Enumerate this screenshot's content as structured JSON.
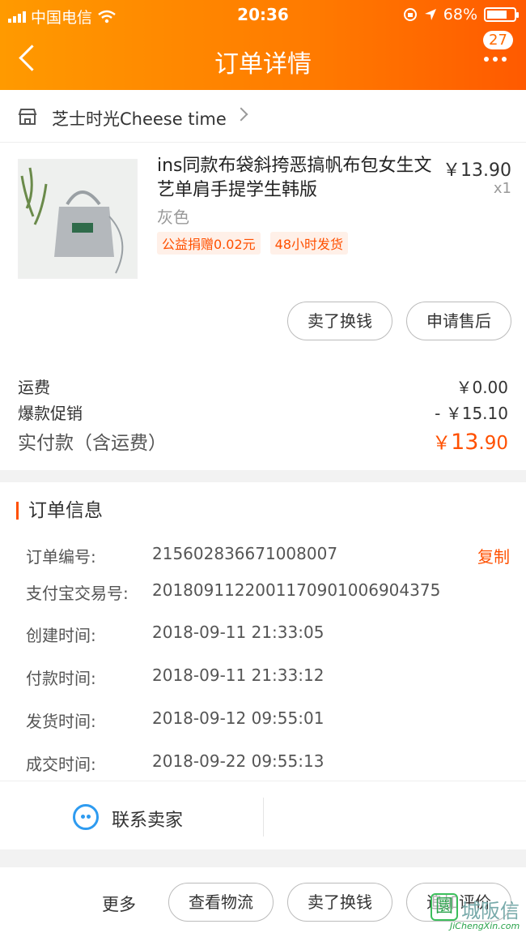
{
  "status_bar": {
    "carrier": "中国电信",
    "time": "20:36",
    "battery": "68%"
  },
  "header": {
    "title": "订单详情",
    "badge_count": "27"
  },
  "shop": {
    "name": "芝士时光Cheese time"
  },
  "product": {
    "title": "ins同款布袋斜挎恶搞帆布包女生文艺单肩手提学生韩版",
    "price": "￥13.90",
    "quantity": "x1",
    "sku": "灰色",
    "tags": [
      "公益捐赠0.02元",
      "48小时发货"
    ],
    "actions": {
      "sell": "卖了换钱",
      "after_sale": "申请售后"
    }
  },
  "fees": {
    "shipping_label": "运费",
    "shipping_value": "￥0.00",
    "promo_label": "爆款促销",
    "promo_value": "- ￥15.10",
    "total_label": "实付款（含运费）",
    "total_currency": "￥",
    "total_int": "13",
    "total_dec": ".90"
  },
  "order_info": {
    "title": "订单信息",
    "copy_label": "复制",
    "rows": [
      {
        "key": "订单编号:",
        "value": "215602836671008007"
      },
      {
        "key": "支付宝交易号:",
        "value": "2018091122001170901006904375"
      },
      {
        "key": "创建时间:",
        "value": "2018-09-11 21:33:05"
      },
      {
        "key": "付款时间:",
        "value": "2018-09-11 21:33:12"
      },
      {
        "key": "发货时间:",
        "value": "2018-09-12 09:55:01"
      },
      {
        "key": "成交时间:",
        "value": "2018-09-22 09:55:13"
      }
    ]
  },
  "contact": {
    "label": "联系卖家"
  },
  "bottom_bar": {
    "more": "更多",
    "logistics": "查看物流",
    "sell": "卖了换钱",
    "review": "追加评价"
  },
  "watermark": {
    "mark": "圜",
    "name": "城阪信",
    "url": "JiChengXin.com"
  },
  "colors": {
    "accent": "#ff5000",
    "header": "#ff7a00",
    "contact_icon": "#2e9bf0"
  }
}
